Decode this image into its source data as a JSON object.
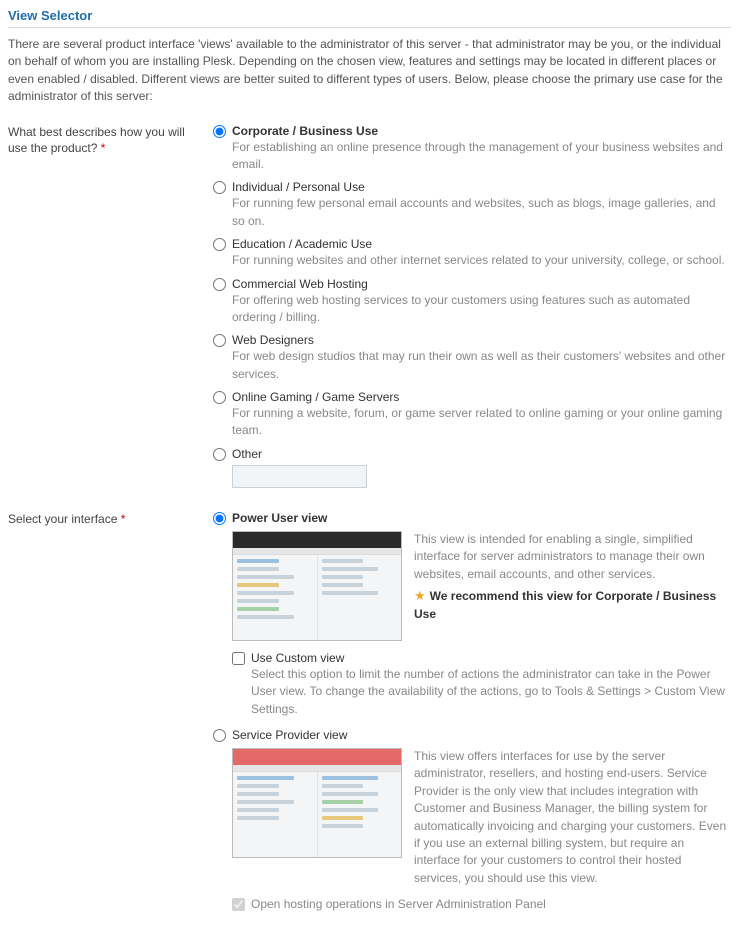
{
  "section_title": "View Selector",
  "intro": "There are several product interface 'views' available to the administrator of this server - that administrator may be you, or the individual on behalf of whom you are installing Plesk. Depending on the chosen view, features and settings may be located in different places or even enabled / disabled. Different views are better suited to different types of users. Below, please choose the primary use case for the administrator of this server:",
  "q1": {
    "label": "What best describes how you will use the product?",
    "options": [
      {
        "title": "Corporate / Business Use",
        "desc": "For establishing an online presence through the management of your business websites and email.",
        "selected": true
      },
      {
        "title": "Individual / Personal Use",
        "desc": "For running few personal email accounts and websites, such as blogs, image galleries, and so on."
      },
      {
        "title": "Education / Academic Use",
        "desc": "For running websites and other internet services related to your university, college, or school."
      },
      {
        "title": "Commercial Web Hosting",
        "desc": "For offering web hosting services to your customers using features such as automated ordering / billing."
      },
      {
        "title": "Web Designers",
        "desc": "For web design studios that may run their own as well as their customers' websites and other services."
      },
      {
        "title": "Online Gaming / Game Servers",
        "desc": "For running a website, forum, or game server related to online gaming or your online gaming team."
      },
      {
        "title": "Other",
        "desc": ""
      }
    ]
  },
  "q2": {
    "label": "Select your interface",
    "power": {
      "title": "Power User view",
      "desc": "This view is intended for enabling a single, simplified interface for server administrators to manage their own websites, email accounts, and other services.",
      "recommend": "We recommend this view for Corporate / Business Use"
    },
    "custom": {
      "title": "Use Custom view",
      "desc": "Select this option to limit the number of actions the administrator can take in the Power User view. To change the availability of the actions, go to Tools & Settings > Custom View Settings."
    },
    "provider": {
      "title": "Service Provider view",
      "desc": "This view offers interfaces for use by the server administrator, resellers, and hosting end-users. Service Provider is the only view that includes integration with Customer and Business Manager, the billing system for automatically invoicing and charging your customers. Even if you use an external billing system, but require an interface for your customers to control their hosted services, you should use this view."
    },
    "open_hosting": {
      "title": "Open hosting operations in Server Administration Panel"
    }
  }
}
